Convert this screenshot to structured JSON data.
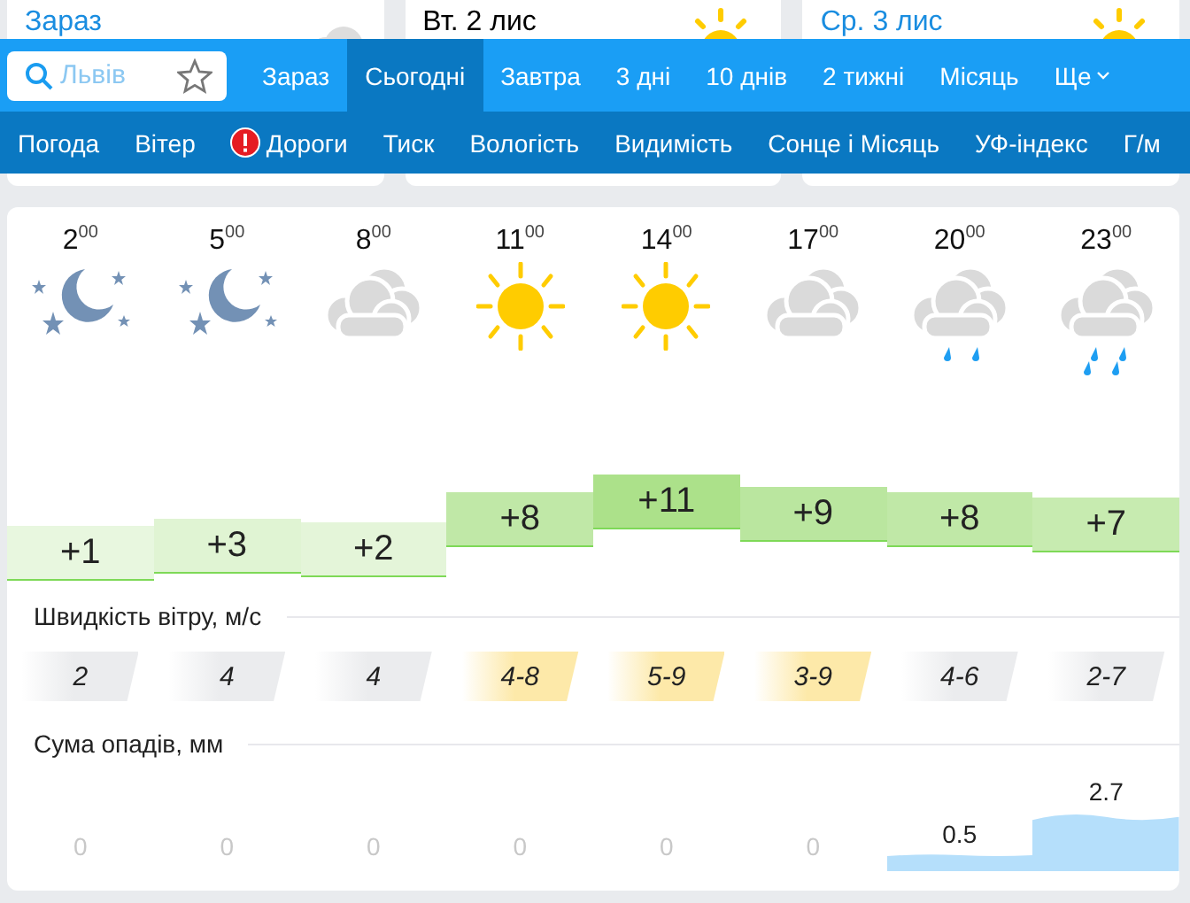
{
  "day_cards": [
    {
      "title": "Зараз",
      "kind": "now"
    },
    {
      "title": "Вт. 2 лис",
      "kind": "day"
    },
    {
      "title": "Ср. 3 лис",
      "kind": "next"
    }
  ],
  "search": {
    "placeholder": "Львів"
  },
  "period_tabs": [
    {
      "label": "Зараз",
      "selected": false
    },
    {
      "label": "Сьогодні",
      "selected": true
    },
    {
      "label": "Завтра",
      "selected": false
    },
    {
      "label": "3 дні",
      "selected": false
    },
    {
      "label": "10 днів",
      "selected": false
    },
    {
      "label": "2 тижні",
      "selected": false
    },
    {
      "label": "Місяць",
      "selected": false
    },
    {
      "label": "Ще",
      "selected": false,
      "kind": "dropdown"
    }
  ],
  "section_tabs": [
    {
      "label": "Погода"
    },
    {
      "label": "Вітер"
    },
    {
      "label": "Дороги",
      "kind": "alert"
    },
    {
      "label": "Тиск"
    },
    {
      "label": "Вологість"
    },
    {
      "label": "Видимість"
    },
    {
      "label": "Сонце і Місяць"
    },
    {
      "label": "УФ-індекс"
    },
    {
      "label": "Г/м"
    }
  ],
  "hours": [
    {
      "time": "2$^{00}$",
      "kind": "night",
      "temp": "+1"
    },
    {
      "time": "5$^{00}$",
      "kind": "night",
      "temp": "+3"
    },
    {
      "time": "8$^{00}$",
      "kind": "cloudy",
      "temp": "+2"
    },
    {
      "time": "11$^{00}$",
      "kind": "sunny",
      "temp": "+8"
    },
    {
      "time": "14$^{00}$",
      "kind": "sunny",
      "temp": "+11"
    },
    {
      "time": "17$^{00}$",
      "kind": "cloudy",
      "temp": "+9"
    },
    {
      "time": "20$^{00}$",
      "kind": "rain",
      "temp": "+8"
    },
    {
      "time": "23$^{00}$",
      "kind": "showers",
      "temp": "+7"
    }
  ],
  "wind": {
    "title": "Швидкість вітру, м/с",
    "values": [
      {
        "text": "2",
        "color": "#ebecee"
      },
      {
        "text": "4",
        "color": "#ebecee"
      },
      {
        "text": "4",
        "color": "#ebecee"
      },
      {
        "text": "4-8",
        "color": "#fde9a9"
      },
      {
        "text": "5-9",
        "color": "#fde9a9"
      },
      {
        "text": "3-9",
        "color": "#fde9a9"
      },
      {
        "text": "4-6",
        "color": "#ebecee"
      },
      {
        "text": "2-7",
        "color": "#ebecee"
      }
    ]
  },
  "precipitation": {
    "title": "Сума опадів, мм",
    "values": [
      {
        "text": "0",
        "kind": "dry"
      },
      {
        "text": "0",
        "kind": "dry"
      },
      {
        "text": "0",
        "kind": "dry"
      },
      {
        "text": "0",
        "kind": "dry"
      },
      {
        "text": "0",
        "kind": "dry"
      },
      {
        "text": "0",
        "kind": "dry"
      },
      {
        "text": "0.5",
        "kind": "wet"
      },
      {
        "text": "2.7",
        "kind": "wet"
      }
    ]
  }
}
